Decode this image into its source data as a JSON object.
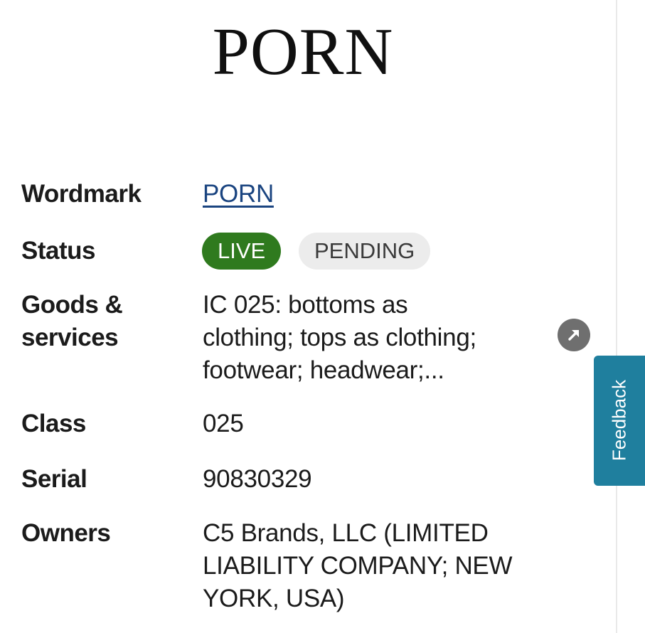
{
  "mark_image_text": "PORN",
  "fields": {
    "wordmark": {
      "label": "Wordmark",
      "value": "PORN"
    },
    "status": {
      "label": "Status",
      "badges": [
        "LIVE",
        "PENDING"
      ]
    },
    "goods": {
      "label_lines": [
        "Goods &",
        "services"
      ],
      "value_lines": [
        "IC 025: bottoms as",
        "clothing; tops as clothing;",
        "footwear; headwear;..."
      ]
    },
    "class": {
      "label": "Class",
      "value": "025"
    },
    "serial": {
      "label": "Serial",
      "value": "90830329"
    },
    "owners": {
      "label": "Owners",
      "value_lines": [
        "C5 Brands, LLC (LIMITED",
        "LIABILITY COMPANY; NEW",
        "YORK, USA)"
      ]
    }
  },
  "feedback_label": "Feedback",
  "colors": {
    "link": "#1a4480",
    "live_badge": "#2f7a1e",
    "pending_badge": "#ececec",
    "feedback_tab": "#1f7f9e",
    "expand_button": "#6f6f6f"
  },
  "icons": {
    "expand": "arrow-up-right-icon"
  }
}
